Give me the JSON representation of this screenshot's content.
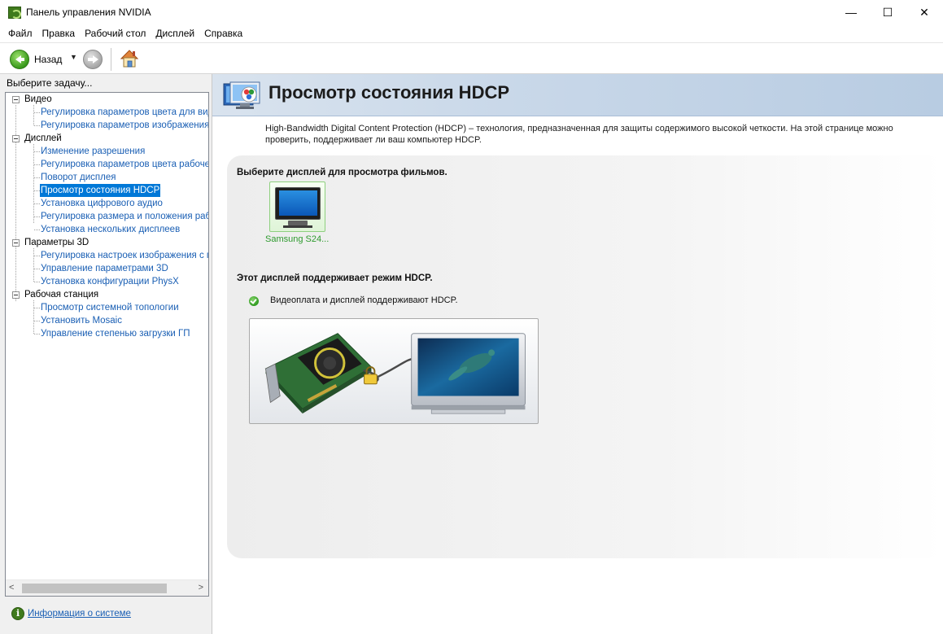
{
  "window": {
    "title": "Панель управления NVIDIA",
    "controls": {
      "minimize": "—",
      "maximize": "☐",
      "close": "✕"
    }
  },
  "menu": [
    "Файл",
    "Правка",
    "Рабочий стол",
    "Дисплей",
    "Справка"
  ],
  "toolbar": {
    "back_label": "Назад",
    "dropdown_glyph": "▼"
  },
  "sidebar": {
    "header": "Выберите задачу...",
    "categories": [
      {
        "label": "Видео",
        "items": [
          "Регулировка параметров цвета для вид",
          "Регулировка параметров изображения д"
        ]
      },
      {
        "label": "Дисплей",
        "items": [
          "Изменение разрешения",
          "Регулировка параметров цвета рабочег",
          "Поворот дисплея",
          "Просмотр состояния HDCP",
          "Установка цифрового аудио",
          "Регулировка размера и положения рабо",
          "Установка нескольких дисплеев"
        ]
      },
      {
        "label": "Параметры 3D",
        "items": [
          "Регулировка настроек изображения с пр",
          "Управление параметрами 3D",
          "Установка конфигурации PhysX"
        ]
      },
      {
        "label": "Рабочая станция",
        "items": [
          "Просмотр системной топологии",
          "Установить Mosaic",
          "Управление степенью загрузки ГП"
        ]
      }
    ],
    "selected_item": "Просмотр состояния HDCP",
    "scroll_left": "<",
    "scroll_right": ">",
    "sysinfo_label": "Информация о системе"
  },
  "main": {
    "title": "Просмотр состояния HDCP",
    "description": "High-Bandwidth Digital Content Protection (HDCP) – технология, предназначенная для защиты содержимого высокой четкости. На этой странице можно проверить, поддерживает ли ваш компьютер HDCP.",
    "select_heading": "Выберите дисплей для просмотра фильмов.",
    "display_name": "Samsung S24...",
    "support_heading": "Этот дисплей поддерживает режим HDCP.",
    "support_status": "Видеоплата и дисплей поддерживают HDCP."
  },
  "colors": {
    "link": "#1a5fb4",
    "selection": "#0078d7",
    "nvidia_green": "#3f7a1c",
    "banner": "#c9d8e9",
    "display_label": "#2d9a2d"
  }
}
